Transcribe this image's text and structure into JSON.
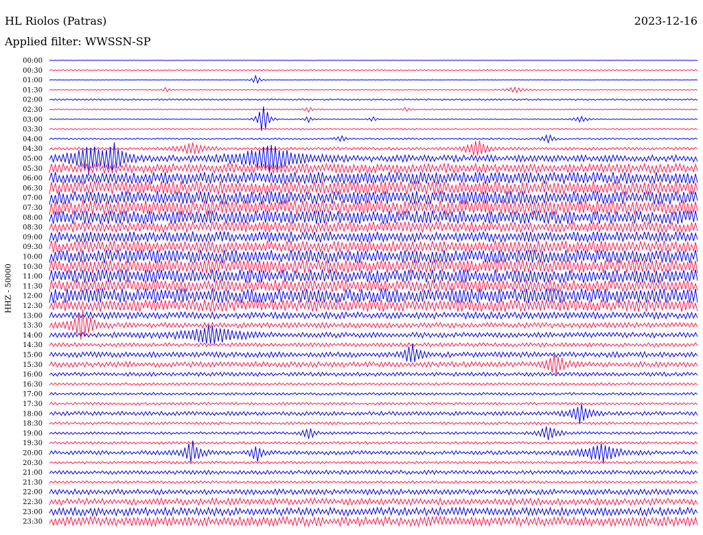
{
  "header": {
    "station": "HL Riolos (Patras)",
    "date": "2023-12-16",
    "filter": "Applied filter: WWSSN-SP"
  },
  "chart_data": {
    "type": "line",
    "ylabel": "HHZ - 50000",
    "colors": {
      "even": "#0000e6",
      "odd": "#ff1a4d"
    },
    "time_labels": [
      "00:00",
      "00:30",
      "01:00",
      "01:30",
      "02:00",
      "02:30",
      "03:00",
      "03:30",
      "04:00",
      "04:30",
      "05:00",
      "05:30",
      "06:00",
      "06:30",
      "07:00",
      "07:30",
      "08:00",
      "08:30",
      "09:00",
      "09:30",
      "10:00",
      "10:30",
      "11:00",
      "11:30",
      "12:00",
      "12:30",
      "13:00",
      "13:30",
      "14:00",
      "14:30",
      "15:00",
      "15:30",
      "16:00",
      "16:30",
      "17:00",
      "17:30",
      "18:00",
      "18:30",
      "19:00",
      "19:30",
      "20:00",
      "20:30",
      "21:00",
      "21:30",
      "22:00",
      "22:30",
      "23:00",
      "23:30"
    ],
    "noise_level": [
      0.3,
      0.8,
      0.3,
      0.6,
      1.2,
      0.8,
      0.6,
      0.9,
      1.2,
      2.2,
      5,
      7,
      9,
      10,
      10,
      11,
      10,
      8,
      8,
      9,
      10,
      10,
      10,
      9,
      11,
      9,
      5,
      4,
      4,
      3,
      4,
      4,
      3,
      2,
      2,
      2,
      3,
      2,
      2,
      2,
      3,
      2,
      3,
      2,
      4,
      5,
      6,
      7
    ],
    "events": [
      {
        "trace": 2,
        "t": 0.32,
        "amp": 9,
        "width": 0.005
      },
      {
        "trace": 3,
        "t": 0.18,
        "amp": 6,
        "width": 0.003
      },
      {
        "trace": 3,
        "t": 0.72,
        "amp": 5,
        "width": 0.012
      },
      {
        "trace": 5,
        "t": 0.4,
        "amp": 5,
        "width": 0.004
      },
      {
        "trace": 5,
        "t": 0.55,
        "amp": 4,
        "width": 0.004
      },
      {
        "trace": 6,
        "t": 0.33,
        "amp": 30,
        "width": 0.006
      },
      {
        "trace": 6,
        "t": 0.4,
        "amp": 6,
        "width": 0.004
      },
      {
        "trace": 6,
        "t": 0.5,
        "amp": 5,
        "width": 0.004
      },
      {
        "trace": 6,
        "t": 0.82,
        "amp": 6,
        "width": 0.008
      },
      {
        "trace": 8,
        "t": 0.45,
        "amp": 6,
        "width": 0.005
      },
      {
        "trace": 8,
        "t": 0.77,
        "amp": 8,
        "width": 0.007
      },
      {
        "trace": 9,
        "t": 0.22,
        "amp": 10,
        "width": 0.015
      },
      {
        "trace": 9,
        "t": 0.66,
        "amp": 14,
        "width": 0.012
      },
      {
        "trace": 10,
        "t": 0.06,
        "amp": 22,
        "width": 0.018
      },
      {
        "trace": 10,
        "t": 0.1,
        "amp": 20,
        "width": 0.012
      },
      {
        "trace": 10,
        "t": 0.34,
        "amp": 20,
        "width": 0.035
      },
      {
        "trace": 27,
        "t": 0.05,
        "amp": 24,
        "width": 0.012
      },
      {
        "trace": 28,
        "t": 0.25,
        "amp": 14,
        "width": 0.03
      },
      {
        "trace": 30,
        "t": 0.56,
        "amp": 16,
        "width": 0.01
      },
      {
        "trace": 31,
        "t": 0.78,
        "amp": 18,
        "width": 0.01
      },
      {
        "trace": 36,
        "t": 0.82,
        "amp": 14,
        "width": 0.012
      },
      {
        "trace": 38,
        "t": 0.4,
        "amp": 12,
        "width": 0.006
      },
      {
        "trace": 38,
        "t": 0.77,
        "amp": 14,
        "width": 0.01
      },
      {
        "trace": 40,
        "t": 0.22,
        "amp": 18,
        "width": 0.01
      },
      {
        "trace": 40,
        "t": 0.85,
        "amp": 16,
        "width": 0.02
      },
      {
        "trace": 40,
        "t": 0.32,
        "amp": 14,
        "width": 0.006
      }
    ]
  }
}
